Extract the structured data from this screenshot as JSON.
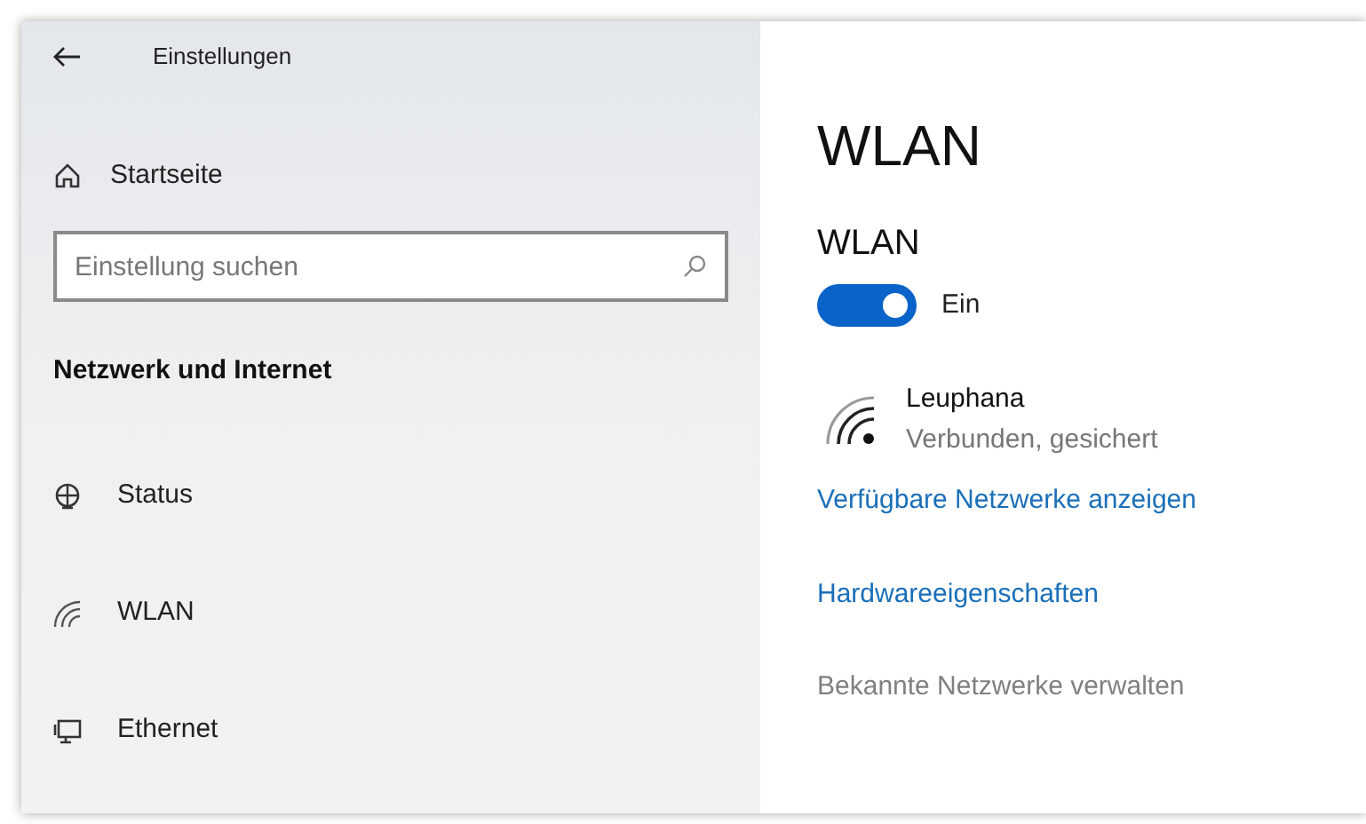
{
  "window": {
    "title": "Einstellungen"
  },
  "sidebar": {
    "home": "Startseite",
    "search": {
      "placeholder": "Einstellung suchen"
    },
    "section": "Netzwerk und Internet",
    "items": [
      {
        "label": "Status",
        "kind": "globe"
      },
      {
        "label": "WLAN",
        "kind": "wifi"
      },
      {
        "label": "Ethernet",
        "kind": "monitor"
      }
    ]
  },
  "page": {
    "title": "WLAN",
    "toggle": {
      "label": "WLAN",
      "on": true,
      "state_text": "Ein"
    },
    "network": {
      "name": "Leuphana",
      "status": "Verbunden, gesichert"
    },
    "links": [
      {
        "label": "Verfügbare Netzwerke anzeigen",
        "disabled": false
      },
      {
        "label": "Hardwareeigenschaften",
        "disabled": false
      },
      {
        "label": "Bekannte Netzwerke verwalten",
        "disabled": true
      }
    ]
  }
}
